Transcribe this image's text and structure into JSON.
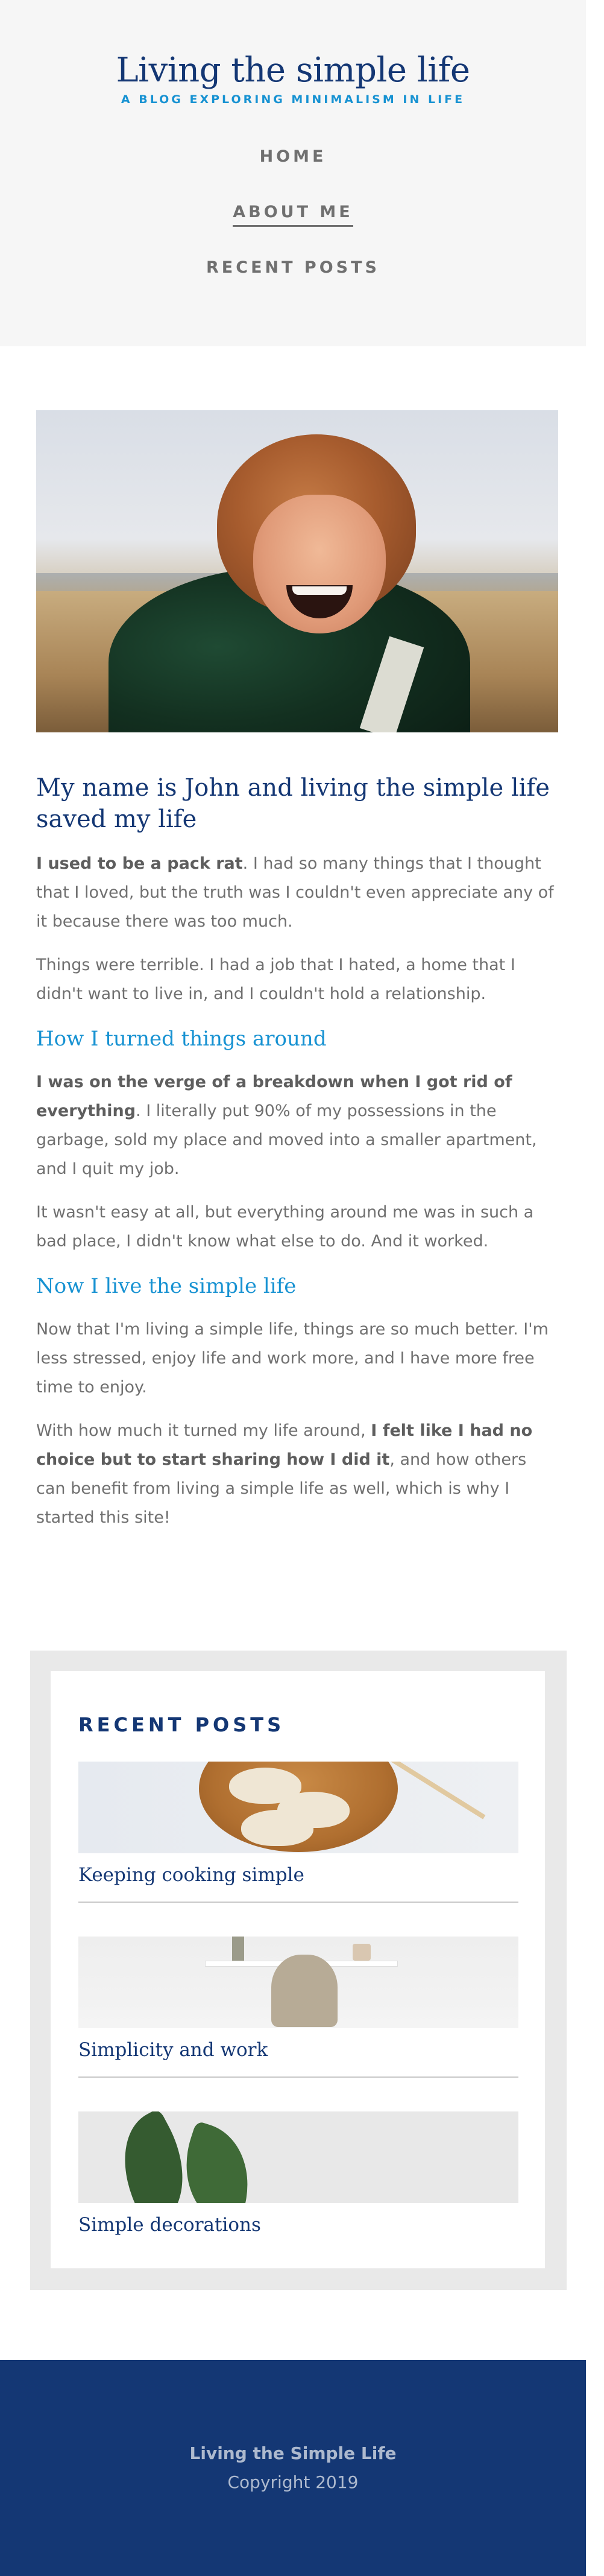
{
  "header": {
    "title": "Living the simple life",
    "subtitle": "A BLOG EXPLORING MINIMALISM IN LIFE",
    "nav": [
      {
        "label": "HOME",
        "active": false
      },
      {
        "label": "ABOUT ME",
        "active": true
      },
      {
        "label": "RECENT POSTS",
        "active": false
      }
    ]
  },
  "article": {
    "heading": "My name is John and living the simple life saved my life",
    "p1_strong": "I used to be a pack rat",
    "p1_rest": ". I had so many things that I thought that I loved, but the truth was I couldn't even appreciate any of it because there was too much.",
    "p2": "Things were terrible. I had a job that I hated, a home that I didn't want to live in, and I couldn't hold a relationship.",
    "h2_1": "How I turned things around",
    "p3_strong": "I was on the verge of a breakdown when I got rid of everything",
    "p3_rest": ". I literally put 90% of my possessions in the garbage, sold my place and moved into a smaller apartment, and I quit my job.",
    "p4": "It wasn't easy at all, but everything around me was in such a bad place, I didn't know what else to do. And it worked.",
    "h2_2": "Now I live the simple life",
    "p5": "Now that I'm living a simple life, things are so much better. I'm less stressed, enjoy life and work more, and I have more free time to enjoy.",
    "p6_start": "With how much it turned my life around, ",
    "p6_strong": "I felt like I had no choice but to start sharing how I did it",
    "p6_rest": ", and how others can benefit from living a simple life as well, which is why I started this site!"
  },
  "sidebar": {
    "title": "RECENT POSTS",
    "posts": [
      {
        "title": "Keeping cooking simple"
      },
      {
        "title": "Simplicity and work"
      },
      {
        "title": "Simple decorations"
      }
    ]
  },
  "footer": {
    "title": "Living the Simple Life",
    "copyright": "Copyright 2019"
  },
  "colors": {
    "brand_navy": "#143774",
    "accent_blue": "#1792d2",
    "body_text": "#707070",
    "header_bg": "#f6f6f6"
  }
}
